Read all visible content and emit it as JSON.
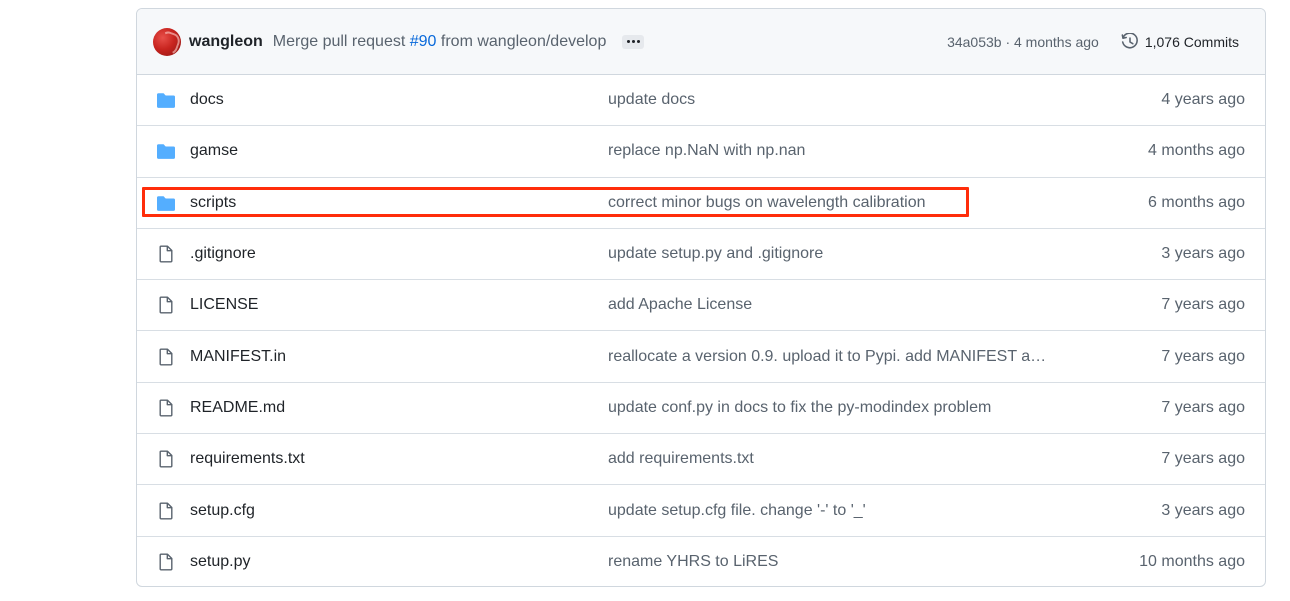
{
  "commit": {
    "author": "wangleon",
    "message_prefix": "Merge pull request",
    "pr_link": "#90",
    "message_suffix": "from wangleon/develop",
    "sha_time": "34a053b · 4 months ago",
    "commits_count": "1,076 Commits"
  },
  "files": [
    {
      "type": "folder",
      "icon": "folder-icon",
      "name": "docs",
      "message": "update docs",
      "age": "4 years ago"
    },
    {
      "type": "folder",
      "icon": "folder-icon",
      "name": "gamse",
      "message": "replace np.NaN with np.nan",
      "age": "4 months ago"
    },
    {
      "type": "folder",
      "icon": "folder-icon",
      "name": "scripts",
      "message": "correct minor bugs on wavelength calibration",
      "age": "6 months ago"
    },
    {
      "type": "file",
      "icon": "file-icon",
      "name": ".gitignore",
      "message": "update setup.py and .gitignore",
      "age": "3 years ago"
    },
    {
      "type": "file",
      "icon": "file-icon",
      "name": "LICENSE",
      "message": "add Apache License",
      "age": "7 years ago"
    },
    {
      "type": "file",
      "icon": "file-icon",
      "name": "MANIFEST.in",
      "message": "reallocate a version 0.9. upload it to Pypi. add MANIFEST a…",
      "age": "7 years ago"
    },
    {
      "type": "file",
      "icon": "file-icon",
      "name": "README.md",
      "message": "update conf.py in docs to fix the py-modindex problem",
      "age": "7 years ago"
    },
    {
      "type": "file",
      "icon": "file-icon",
      "name": "requirements.txt",
      "message": "add requirements.txt",
      "age": "7 years ago"
    },
    {
      "type": "file",
      "icon": "file-icon",
      "name": "setup.cfg",
      "message": "update setup.cfg file. change '-' to '_'",
      "age": "3 years ago"
    },
    {
      "type": "file",
      "icon": "file-icon",
      "name": "setup.py",
      "message": "rename YHRS to LiRES",
      "age": "10 months ago"
    }
  ],
  "colors": {
    "folder": "#54aeff",
    "link": "#0969da",
    "highlight": "#ff2d0a"
  }
}
